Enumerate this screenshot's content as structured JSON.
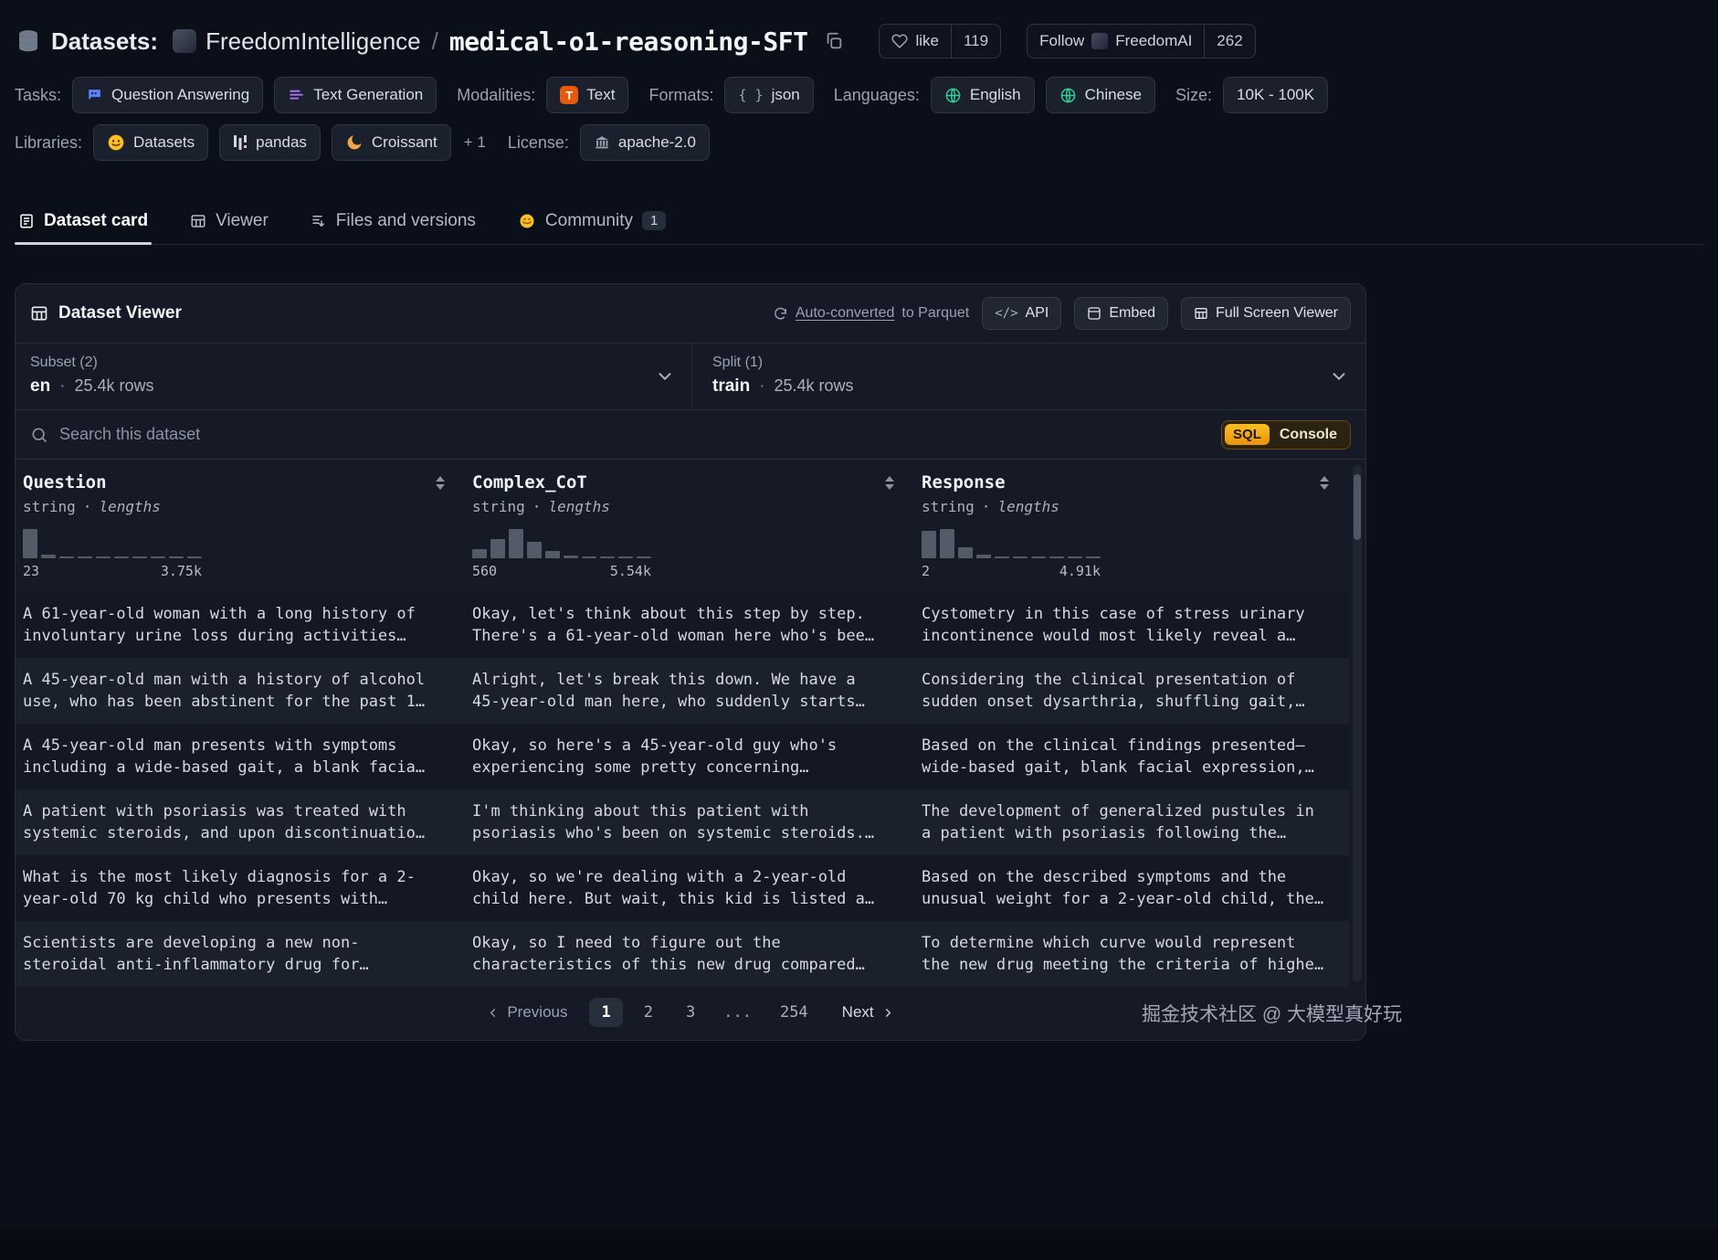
{
  "header": {
    "section_label": "Datasets:",
    "org": "FreedomIntelligence",
    "separator": "/",
    "dataset_name": "medical-o1-reasoning-SFT",
    "like_label": "like",
    "like_count": "119",
    "follow_label": "Follow",
    "follow_org": "FreedomAI",
    "follow_count": "262"
  },
  "meta": {
    "tasks_label": "Tasks:",
    "tasks": [
      "Question Answering",
      "Text Generation"
    ],
    "modalities_label": "Modalities:",
    "modalities": [
      "Text"
    ],
    "formats_label": "Formats:",
    "formats": [
      "json"
    ],
    "languages_label": "Languages:",
    "languages": [
      "English",
      "Chinese"
    ],
    "size_label": "Size:",
    "size": "10K - 100K",
    "libraries_label": "Libraries:",
    "libraries": [
      "Datasets",
      "pandas",
      "Croissant"
    ],
    "libraries_more": "+ 1",
    "license_label": "License:",
    "license": "apache-2.0"
  },
  "tabs": [
    {
      "label": "Dataset card"
    },
    {
      "label": "Viewer"
    },
    {
      "label": "Files and versions"
    },
    {
      "label": "Community",
      "badge": "1"
    }
  ],
  "viewer": {
    "title": "Dataset Viewer",
    "auto_converted_link": "Auto-converted",
    "auto_converted_rest": "to Parquet",
    "api_label": "API",
    "embed_label": "Embed",
    "fullscreen_label": "Full Screen Viewer",
    "subset_label": "Subset (2)",
    "subset_value": "en",
    "dot": "·",
    "subset_rows": "25.4k rows",
    "split_label": "Split (1)",
    "split_value": "train",
    "split_rows": "25.4k rows",
    "search_placeholder": "Search this dataset",
    "sql_label": "SQL",
    "console_label": "Console"
  },
  "icons": {
    "api": "</>",
    "braces": "{ }",
    "text_modality": "T"
  },
  "table": {
    "columns": [
      {
        "name": "Question",
        "type": "string",
        "subtype": "lengths",
        "min": "23",
        "max": "3.75k",
        "hist": [
          100,
          12,
          7,
          5,
          4,
          3,
          3,
          2,
          2,
          2
        ]
      },
      {
        "name": "Complex_CoT",
        "type": "string",
        "subtype": "lengths",
        "min": "560",
        "max": "5.54k",
        "hist": [
          30,
          65,
          100,
          55,
          25,
          10,
          5,
          3,
          2,
          2
        ]
      },
      {
        "name": "Response",
        "type": "string",
        "subtype": "lengths",
        "min": "2",
        "max": "4.91k",
        "hist": [
          95,
          100,
          38,
          14,
          7,
          4,
          3,
          2,
          2,
          2
        ]
      }
    ],
    "rows": [
      {
        "question": "A 61-year-old woman with a long history of involuntary urine loss during activities…",
        "cot": "Okay, let's think about this step by step. There's a 61-year-old woman here who's bee…",
        "response": "Cystometry in this case of stress urinary incontinence would most likely reveal a…"
      },
      {
        "question": "A 45-year-old man with a history of alcohol use, who has been abstinent for the past 1…",
        "cot": "Alright, let's break this down. We have a 45-year-old man here, who suddenly starts…",
        "response": "Considering the clinical presentation of sudden onset dysarthria, shuffling gait,…"
      },
      {
        "question": "A 45-year-old man presents with symptoms including a wide-based gait, a blank facia…",
        "cot": "Okay, so here's a 45-year-old guy who's experiencing some pretty concerning…",
        "response": "Based on the clinical findings presented—wide-based gait, blank facial expression,…"
      },
      {
        "question": "A patient with psoriasis was treated with systemic steroids, and upon discontinuatio…",
        "cot": "I'm thinking about this patient with psoriasis who's been on systemic steroids.…",
        "response": "The development of generalized pustules in a patient with psoriasis following the…"
      },
      {
        "question": "What is the most likely diagnosis for a 2-year-old 70 kg child who presents with…",
        "cot": "Okay, so we're dealing with a 2-year-old child here. But wait, this kid is listed a…",
        "response": "Based on the described symptoms and the unusual weight for a 2-year-old child, the…"
      },
      {
        "question": "Scientists are developing a new non-steroidal anti-inflammatory drug for…",
        "cot": "Okay, so I need to figure out the characteristics of this new drug compared…",
        "response": "To determine which curve would represent the new drug meeting the criteria of highe…"
      }
    ]
  },
  "pagination": {
    "previous_label": "Previous",
    "pages": [
      "1",
      "2",
      "3",
      "...",
      "254"
    ],
    "next_label": "Next"
  },
  "watermark": "掘金技术社区 @ 大模型真好玩"
}
